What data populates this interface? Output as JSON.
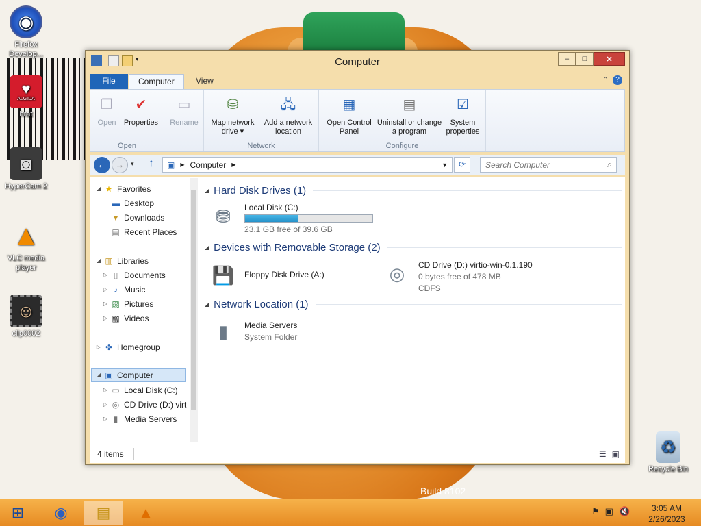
{
  "desktop": {
    "icons": [
      {
        "label": "Firefox Develop...",
        "icon": "firefox-icon"
      },
      {
        "label": "hrat",
        "icon": "algida-icon"
      },
      {
        "label": "HyperCam 2",
        "icon": "hypercam-icon"
      },
      {
        "label": "VLC media player",
        "icon": "vlc-icon"
      },
      {
        "label": "clip0002",
        "icon": "video-file-icon"
      },
      {
        "label": "Recycle Bin",
        "icon": "recycle-bin-icon"
      }
    ],
    "algida_text": "ALGIDA",
    "build_text": "Build 8102"
  },
  "window": {
    "title": "Computer",
    "controls": {
      "minimize": "–",
      "maximize": "□",
      "close": "✕"
    },
    "tabs": [
      {
        "label": "File"
      },
      {
        "label": "Computer"
      },
      {
        "label": "View"
      }
    ],
    "ribbon": {
      "groups": [
        {
          "label": "Open",
          "buttons": [
            {
              "label": "Open",
              "icon": "open-icon",
              "enabled": false
            },
            {
              "label": "Properties",
              "icon": "properties-icon",
              "enabled": true
            }
          ]
        },
        {
          "label": "",
          "buttons": [
            {
              "label": "Rename",
              "icon": "rename-icon",
              "enabled": false
            }
          ]
        },
        {
          "label": "Network",
          "buttons": [
            {
              "label": "Map network drive ▾",
              "icon": "map-network-drive-icon",
              "enabled": true
            },
            {
              "label": "Add a network location",
              "icon": "add-network-location-icon",
              "enabled": true
            }
          ]
        },
        {
          "label": "Configure",
          "buttons": [
            {
              "label": "Open Control Panel",
              "icon": "control-panel-icon",
              "enabled": true
            },
            {
              "label": "Uninstall or change a program",
              "icon": "uninstall-icon",
              "enabled": true
            },
            {
              "label": "System properties",
              "icon": "system-properties-icon",
              "enabled": true
            }
          ]
        }
      ]
    },
    "address": {
      "path": "Computer"
    },
    "search": {
      "placeholder": "Search Computer"
    },
    "nav_pane": {
      "items": [
        {
          "label": "Favorites",
          "level": 0,
          "icon": "star-icon",
          "expander": "◢"
        },
        {
          "label": "Desktop",
          "level": 1,
          "icon": "desktop-icon"
        },
        {
          "label": "Downloads",
          "level": 1,
          "icon": "downloads-icon"
        },
        {
          "label": "Recent Places",
          "level": 1,
          "icon": "recent-places-icon"
        },
        {
          "label": "Libraries",
          "level": 0,
          "icon": "libraries-icon",
          "expander": "◢"
        },
        {
          "label": "Documents",
          "level": 1,
          "icon": "documents-icon",
          "expander": "▷"
        },
        {
          "label": "Music",
          "level": 1,
          "icon": "music-icon",
          "expander": "▷"
        },
        {
          "label": "Pictures",
          "level": 1,
          "icon": "pictures-icon",
          "expander": "▷"
        },
        {
          "label": "Videos",
          "level": 1,
          "icon": "videos-icon",
          "expander": "▷"
        },
        {
          "label": "Homegroup",
          "level": 0,
          "icon": "homegroup-icon",
          "expander": "▷"
        },
        {
          "label": "Computer",
          "level": 0,
          "icon": "computer-icon",
          "expander": "◢",
          "selected": true
        },
        {
          "label": "Local Disk (C:)",
          "level": 1,
          "icon": "local-disk-icon",
          "expander": "▷"
        },
        {
          "label": "CD Drive (D:) virt",
          "level": 1,
          "icon": "cd-drive-icon",
          "expander": "▷"
        },
        {
          "label": "Media Servers",
          "level": 1,
          "icon": "media-servers-icon",
          "expander": "▷"
        }
      ]
    },
    "groups": [
      {
        "header": "Hard Disk Drives (1)"
      },
      {
        "header": "Devices with Removable Storage (2)"
      },
      {
        "header": "Network Location (1)"
      }
    ],
    "items": {
      "local_disk": {
        "name": "Local Disk (C:)",
        "free": "23.1 GB free of 39.6 GB",
        "used_fraction": 0.42
      },
      "floppy": {
        "name": "Floppy Disk Drive (A:)"
      },
      "cd": {
        "name": "CD Drive (D:) virtio-win-0.1.190",
        "free": "0 bytes free of 478 MB",
        "fs": "CDFS"
      },
      "media": {
        "name": "Media Servers",
        "type": "System Folder"
      }
    },
    "status": {
      "count": "4 items"
    }
  },
  "taskbar": {
    "items": [
      {
        "name": "start-button",
        "icon": "windows-logo-icon"
      },
      {
        "name": "firefox",
        "icon": "firefox-icon"
      },
      {
        "name": "file-explorer",
        "icon": "file-explorer-icon",
        "active": true
      },
      {
        "name": "vlc",
        "icon": "vlc-icon"
      }
    ],
    "clock": {
      "time": "3:05 AM",
      "date": "2/26/2023"
    }
  },
  "colors": {
    "taskbar": "#e68a23",
    "accent": "#1f65b8",
    "window_frame": "#f5deac",
    "close": "#c9433b"
  }
}
